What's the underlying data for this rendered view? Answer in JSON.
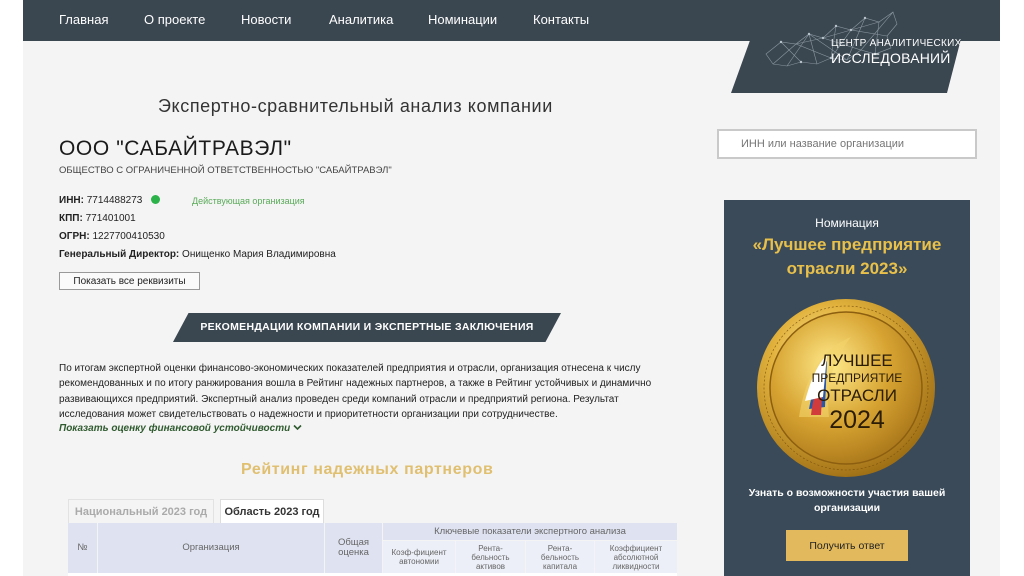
{
  "nav": {
    "items": [
      {
        "label": "Главная"
      },
      {
        "label": "О проекте"
      },
      {
        "label": "Новости"
      },
      {
        "label": "Аналитика"
      },
      {
        "label": "Номинации"
      },
      {
        "label": "Контакты"
      }
    ]
  },
  "logo": {
    "line1": "ЦЕНТР АНАЛИТИЧЕСКИХ",
    "line2": "ИССЛЕДОВАНИЙ"
  },
  "page_heading": "Экспертно-сравнительный анализ компании",
  "search": {
    "placeholder": "ИНН или название организации"
  },
  "company": {
    "name": "ООО \"САБАЙТРАВЭЛ\"",
    "full_name": "ОБЩЕСТВО С ОГРАНИЧЕННОЙ ОТВЕТСТВЕННОСТЬЮ \"САБАЙТРАВЭЛ\"",
    "inn_label": "ИНН:",
    "inn": "7714488273",
    "status": "Действующая организация",
    "status_color": "#2bb34a",
    "kpp_label": "КПП:",
    "kpp": "771401001",
    "ogrn_label": "ОГРН:",
    "ogrn": "1227700410530",
    "director_label": "Генеральный Директор:",
    "director": "Онищенко Мария Владимировна",
    "show_details_button": "Показать все реквизиты"
  },
  "recommendations": {
    "title": "РЕКОМЕНДАЦИИ КОМПАНИИ И ЭКСПЕРТНЫЕ ЗАКЛЮЧЕНИЯ",
    "text": "По итогам экспертной оценки финансово-экономических показателей предприятия и отрасли, организация отнесена к числу рекомендованных и по итогу ранжирования вошла в Рейтинг надежных партнеров, а также в Рейтинг устойчивых и динамично развивающихся предприятий. Экспертный анализ проведен среди компаний отрасли и предприятий региона. Результат исследования может свидетельствовать о надежности и приоритетности организации при сотрудничестве.",
    "show_link": "Показать оценку финансовой устойчивости"
  },
  "rating": {
    "title": "Рейтинг надежных партнеров",
    "tabs": [
      {
        "label": "Национальный 2023 год"
      },
      {
        "label": "Область 2023 год"
      }
    ],
    "headers": {
      "num": "№",
      "org": "Организация",
      "total": "Общая оценка",
      "key": "Ключевые показатели экспертного анализа",
      "sub": [
        "Коэф-фициент автономии",
        "Рента-бельность активов",
        "Рента-бельность капитала",
        "Коэффициент абсолютной ликвидности"
      ]
    }
  },
  "banner": {
    "nomination": "Номинация",
    "title": "«Лучшее предприятие отрасли 2023»",
    "medal_line1": "ЛУЧШЕЕ",
    "medal_line2": "ПРЕДПРИЯТИЕ",
    "medal_line3": "ОТРАСЛИ",
    "medal_year": "2024",
    "text": "Узнать о возможности участия вашей организации",
    "button": "Получить ответ"
  }
}
